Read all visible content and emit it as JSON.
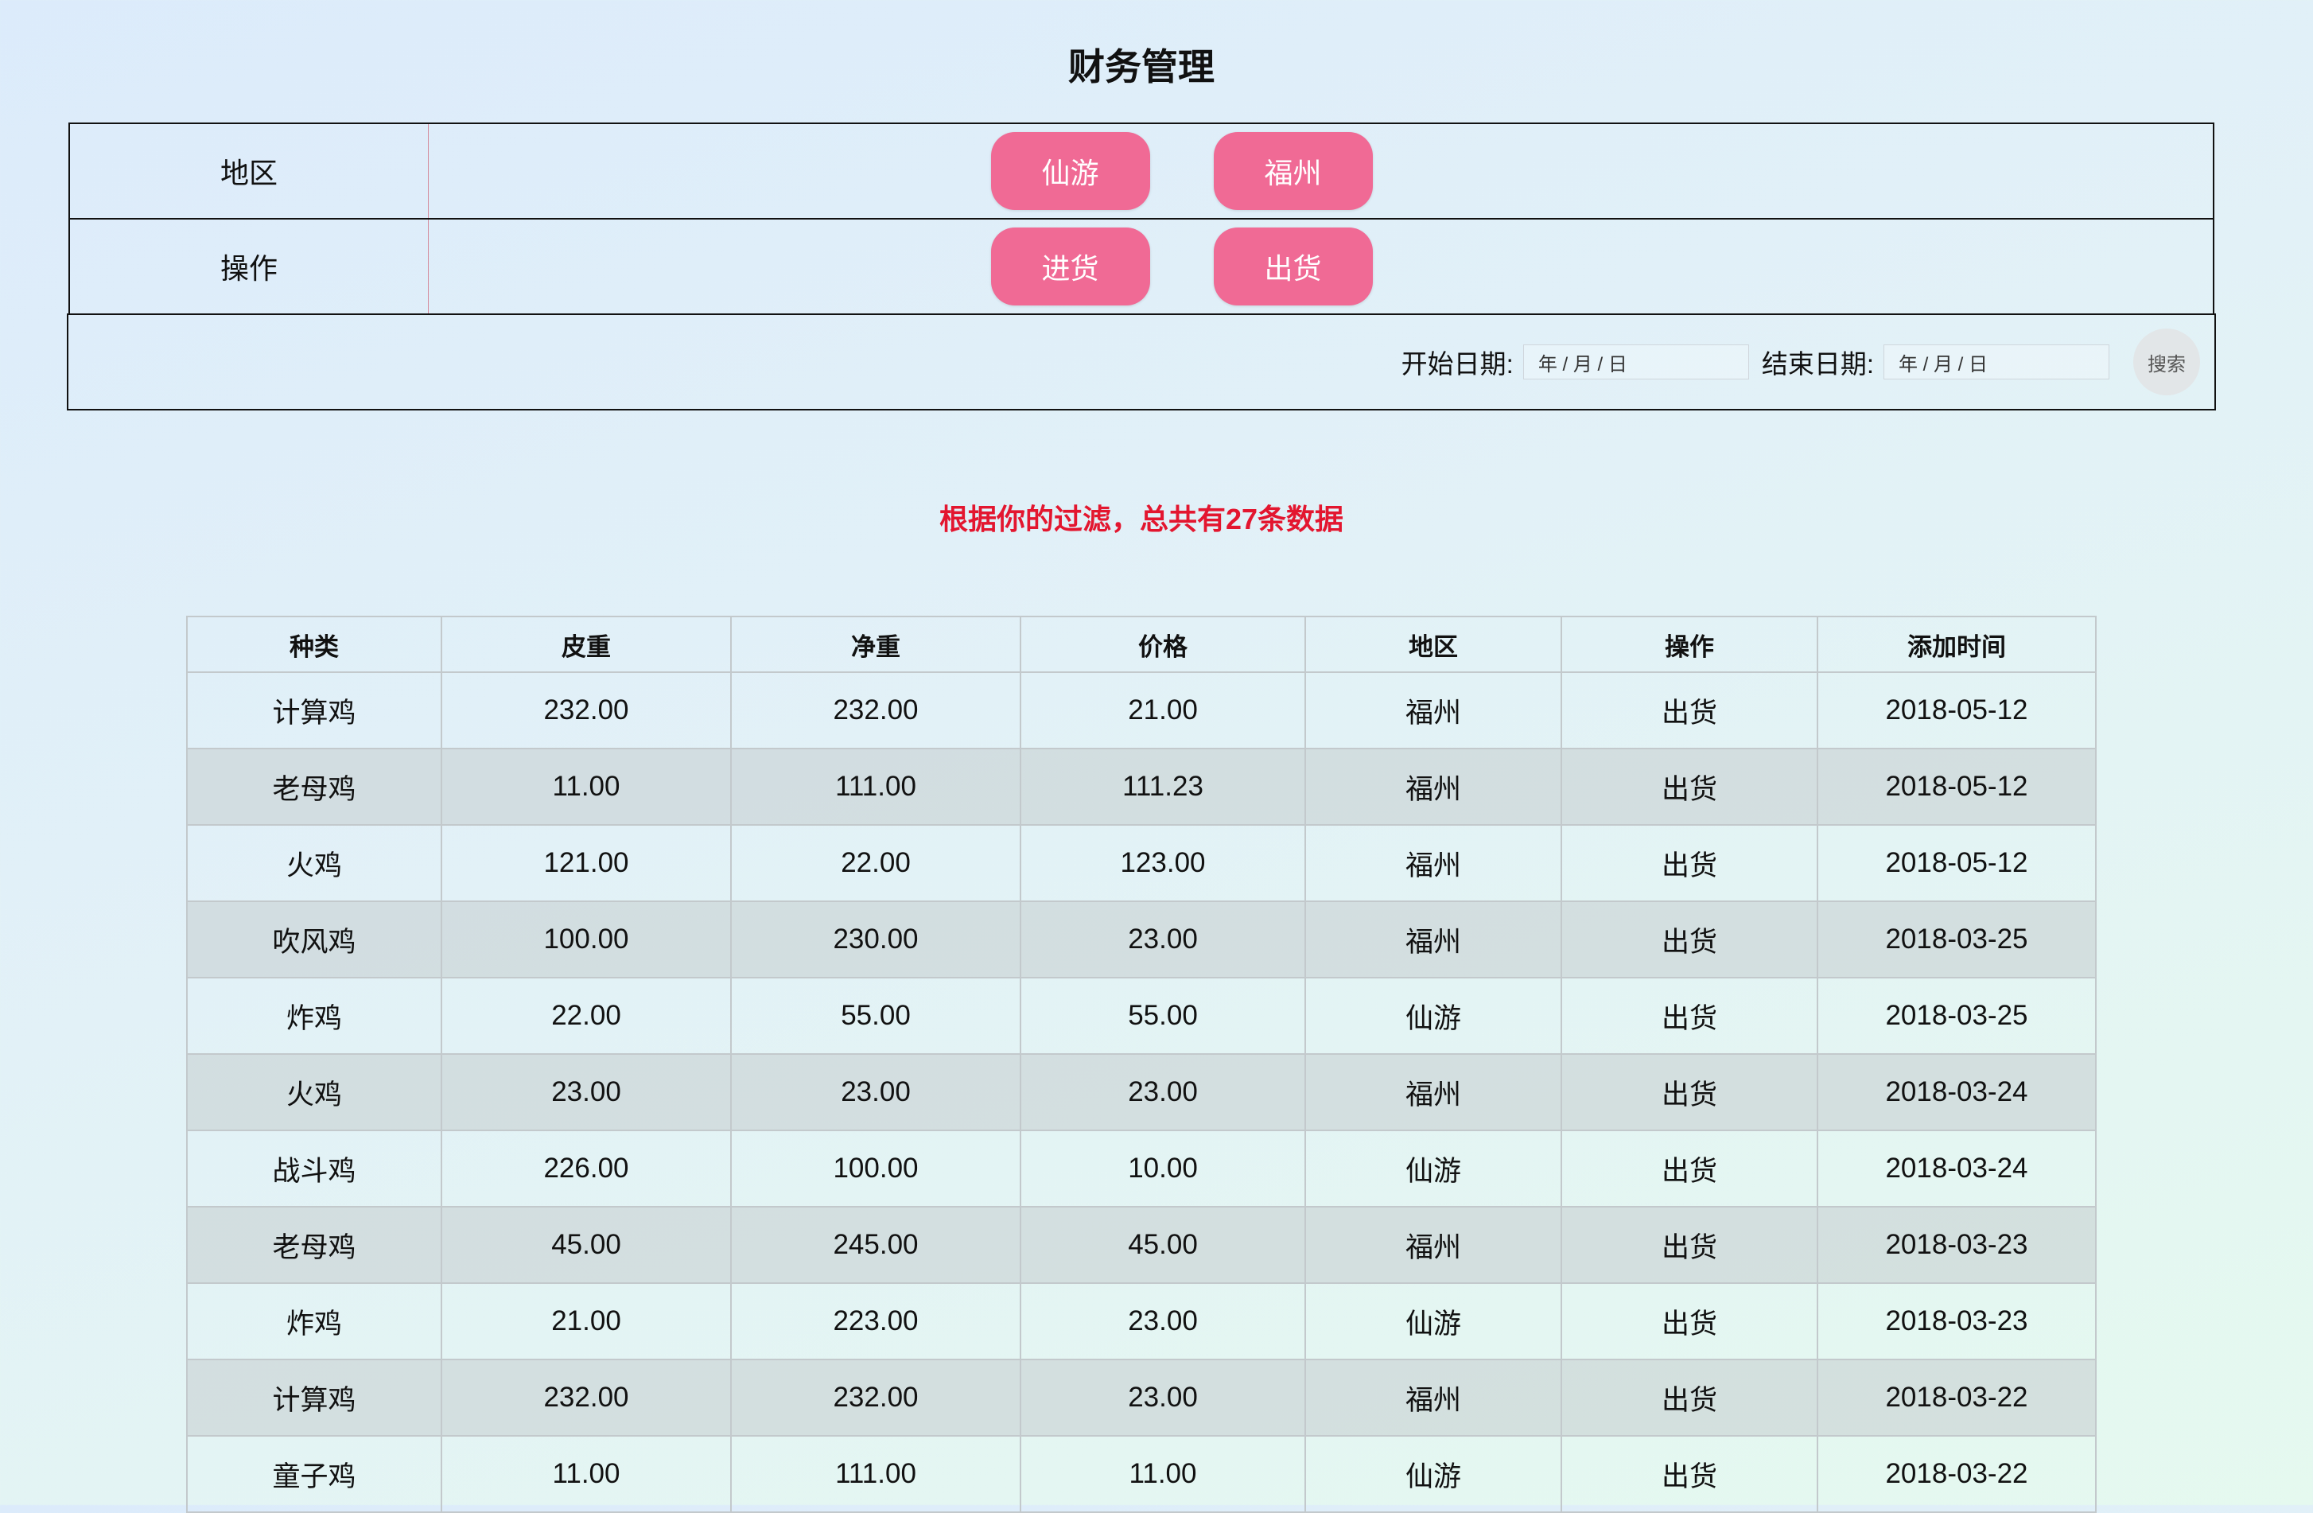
{
  "page": {
    "title": "财务管理"
  },
  "filters": {
    "region": {
      "label": "地区",
      "options": [
        "仙游",
        "福州"
      ]
    },
    "operation": {
      "label": "操作",
      "options": [
        "进货",
        "出货"
      ]
    },
    "date_range": {
      "start_label": "开始日期:",
      "start_value": "年 / 月 / 日",
      "end_label": "结束日期:",
      "end_value": "年 / 月 / 日",
      "search_label": "搜索"
    }
  },
  "summary": {
    "text": "根据你的过滤，总共有27条数据"
  },
  "colors": {
    "pill_button": "#f06a95",
    "summary_text": "#e3162f"
  },
  "table": {
    "columns": [
      "种类",
      "皮重",
      "净重",
      "价格",
      "地区",
      "操作",
      "添加时间"
    ],
    "rows": [
      [
        "计算鸡",
        "232.00",
        "232.00",
        "21.00",
        "福州",
        "出货",
        "2018-05-12"
      ],
      [
        "老母鸡",
        "11.00",
        "111.00",
        "111.23",
        "福州",
        "出货",
        "2018-05-12"
      ],
      [
        "火鸡",
        "121.00",
        "22.00",
        "123.00",
        "福州",
        "出货",
        "2018-05-12"
      ],
      [
        "吹风鸡",
        "100.00",
        "230.00",
        "23.00",
        "福州",
        "出货",
        "2018-03-25"
      ],
      [
        "炸鸡",
        "22.00",
        "55.00",
        "55.00",
        "仙游",
        "出货",
        "2018-03-25"
      ],
      [
        "火鸡",
        "23.00",
        "23.00",
        "23.00",
        "福州",
        "出货",
        "2018-03-24"
      ],
      [
        "战斗鸡",
        "226.00",
        "100.00",
        "10.00",
        "仙游",
        "出货",
        "2018-03-24"
      ],
      [
        "老母鸡",
        "45.00",
        "245.00",
        "45.00",
        "福州",
        "出货",
        "2018-03-23"
      ],
      [
        "炸鸡",
        "21.00",
        "223.00",
        "23.00",
        "仙游",
        "出货",
        "2018-03-23"
      ],
      [
        "计算鸡",
        "232.00",
        "232.00",
        "23.00",
        "福州",
        "出货",
        "2018-03-22"
      ],
      [
        "童子鸡",
        "11.00",
        "111.00",
        "11.00",
        "仙游",
        "出货",
        "2018-03-22"
      ]
    ]
  }
}
